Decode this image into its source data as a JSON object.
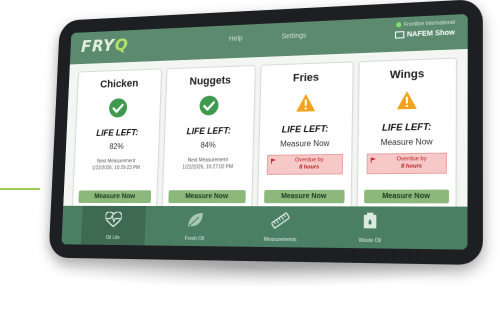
{
  "app": {
    "logo_main": "FRY",
    "logo_accent": "Q"
  },
  "nav": {
    "help": "Help",
    "settings": "Settings"
  },
  "status": {
    "org": "Frontline International",
    "show": "NAFEM Show"
  },
  "cards": [
    {
      "name": "Chicken",
      "state": "ok",
      "life_label": "LIFE LEFT:",
      "value": "82%",
      "next_label": "Next Measurement",
      "next_time": "1/22/2026, 10:29:23 PM",
      "button": "Measure Now"
    },
    {
      "name": "Nuggets",
      "state": "ok",
      "life_label": "LIFE LEFT:",
      "value": "84%",
      "next_label": "Next Measurement",
      "next_time": "1/22/2026, 10:27:02 PM",
      "button": "Measure Now"
    },
    {
      "name": "Fries",
      "state": "warn",
      "life_label": "LIFE LEFT:",
      "value": "Measure Now",
      "overdue_label": "Overdue by",
      "overdue_time": "8 hours",
      "button": "Measure Now"
    },
    {
      "name": "Wings",
      "state": "warn",
      "life_label": "LIFE LEFT:",
      "value": "Measure Now",
      "overdue_label": "Overdue by",
      "overdue_time": "8 hours",
      "button": "Measure Now"
    }
  ],
  "tabs": [
    {
      "label": "Oil Life",
      "icon": "heartbeat-icon",
      "active": true
    },
    {
      "label": "Fresh Oil",
      "icon": "leaf-icon",
      "active": false
    },
    {
      "label": "Measurements",
      "icon": "ruler-icon",
      "active": false
    },
    {
      "label": "Waste Oil",
      "icon": "waste-container-icon",
      "active": false
    }
  ],
  "colors": {
    "topbar": "#5b8a6e",
    "bottombar": "#4b7f63",
    "ok": "#3f9a4f",
    "warn": "#f2a31d",
    "button": "#8cb87c",
    "overdue_bg": "#f6c8c8"
  }
}
